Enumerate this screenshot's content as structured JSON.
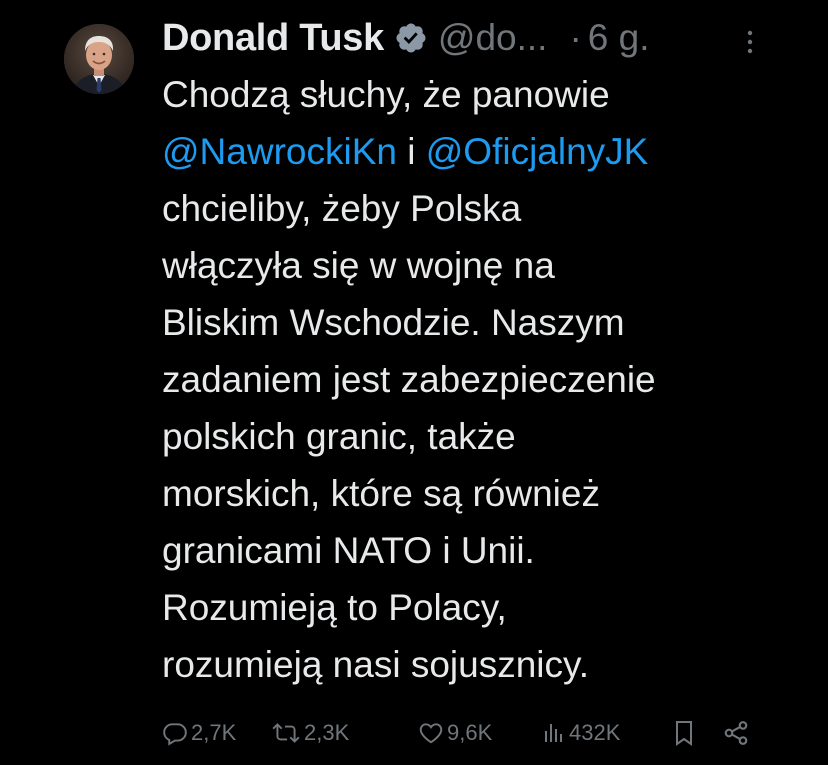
{
  "author": {
    "display_name": "Donald Tusk",
    "handle": "@do...",
    "separator": "·",
    "time": "6 g.",
    "avatar_icon": "avatar-photo",
    "verified_icon": "verified-badge-icon",
    "more_icon": "more-options-icon"
  },
  "tweet": {
    "lines": [
      {
        "text": "Chodzą słuchy, że panowie"
      },
      {
        "mention_a": "@NawrockiKn",
        "between": " i ",
        "mention_b": "@OficjalnyJK"
      },
      {
        "text": "chcieliby, żeby Polska"
      },
      {
        "text": "włączyła się w wojnę na"
      },
      {
        "text": "Bliskim Wschodzie. Naszym"
      },
      {
        "text": "zadaniem jest zabezpieczenie"
      },
      {
        "text": "polskich granic, także"
      },
      {
        "text": "morskich, które są również"
      },
      {
        "text": "granicami NATO i Unii."
      },
      {
        "text": "Rozumieją to Polacy,"
      },
      {
        "text": "rozumieją nasi sojusznicy."
      }
    ]
  },
  "actions": {
    "replies": {
      "icon": "reply-icon",
      "count": "2,7K"
    },
    "reposts": {
      "icon": "repost-icon",
      "count": "2,3K"
    },
    "likes": {
      "icon": "heart-icon",
      "count": "9,6K"
    },
    "views": {
      "icon": "views-icon",
      "count": "432K"
    },
    "bookmark": {
      "icon": "bookmark-icon"
    },
    "share": {
      "icon": "share-icon"
    }
  },
  "colors": {
    "background": "#000000",
    "text": "#e7e9ea",
    "secondary": "#71767b",
    "mention": "#1d9bf0"
  }
}
